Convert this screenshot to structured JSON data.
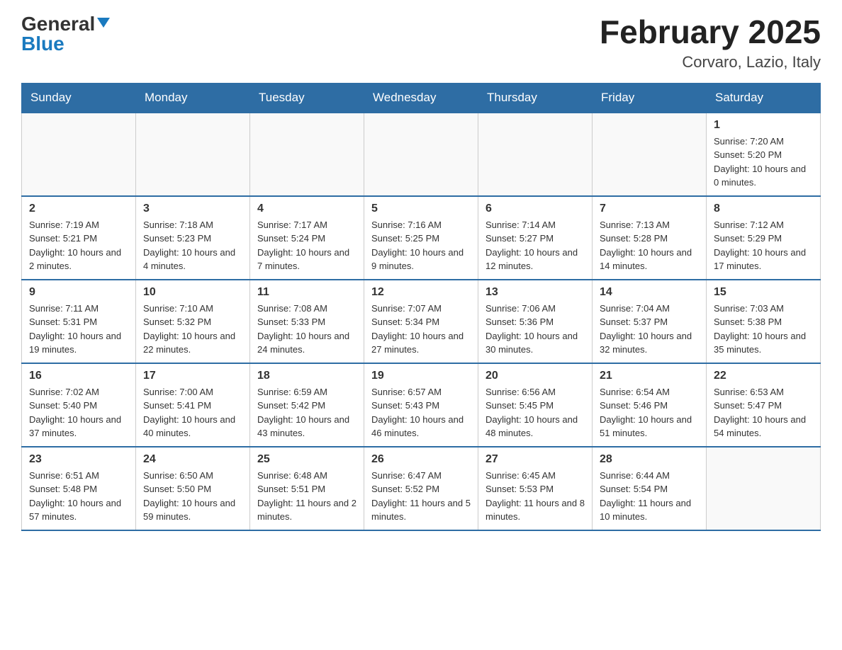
{
  "logo": {
    "general": "General",
    "blue": "Blue"
  },
  "header": {
    "month_title": "February 2025",
    "location": "Corvaro, Lazio, Italy"
  },
  "weekdays": [
    "Sunday",
    "Monday",
    "Tuesday",
    "Wednesday",
    "Thursday",
    "Friday",
    "Saturday"
  ],
  "weeks": [
    [
      {
        "day": "",
        "info": ""
      },
      {
        "day": "",
        "info": ""
      },
      {
        "day": "",
        "info": ""
      },
      {
        "day": "",
        "info": ""
      },
      {
        "day": "",
        "info": ""
      },
      {
        "day": "",
        "info": ""
      },
      {
        "day": "1",
        "info": "Sunrise: 7:20 AM\nSunset: 5:20 PM\nDaylight: 10 hours and 0 minutes."
      }
    ],
    [
      {
        "day": "2",
        "info": "Sunrise: 7:19 AM\nSunset: 5:21 PM\nDaylight: 10 hours and 2 minutes."
      },
      {
        "day": "3",
        "info": "Sunrise: 7:18 AM\nSunset: 5:23 PM\nDaylight: 10 hours and 4 minutes."
      },
      {
        "day": "4",
        "info": "Sunrise: 7:17 AM\nSunset: 5:24 PM\nDaylight: 10 hours and 7 minutes."
      },
      {
        "day": "5",
        "info": "Sunrise: 7:16 AM\nSunset: 5:25 PM\nDaylight: 10 hours and 9 minutes."
      },
      {
        "day": "6",
        "info": "Sunrise: 7:14 AM\nSunset: 5:27 PM\nDaylight: 10 hours and 12 minutes."
      },
      {
        "day": "7",
        "info": "Sunrise: 7:13 AM\nSunset: 5:28 PM\nDaylight: 10 hours and 14 minutes."
      },
      {
        "day": "8",
        "info": "Sunrise: 7:12 AM\nSunset: 5:29 PM\nDaylight: 10 hours and 17 minutes."
      }
    ],
    [
      {
        "day": "9",
        "info": "Sunrise: 7:11 AM\nSunset: 5:31 PM\nDaylight: 10 hours and 19 minutes."
      },
      {
        "day": "10",
        "info": "Sunrise: 7:10 AM\nSunset: 5:32 PM\nDaylight: 10 hours and 22 minutes."
      },
      {
        "day": "11",
        "info": "Sunrise: 7:08 AM\nSunset: 5:33 PM\nDaylight: 10 hours and 24 minutes."
      },
      {
        "day": "12",
        "info": "Sunrise: 7:07 AM\nSunset: 5:34 PM\nDaylight: 10 hours and 27 minutes."
      },
      {
        "day": "13",
        "info": "Sunrise: 7:06 AM\nSunset: 5:36 PM\nDaylight: 10 hours and 30 minutes."
      },
      {
        "day": "14",
        "info": "Sunrise: 7:04 AM\nSunset: 5:37 PM\nDaylight: 10 hours and 32 minutes."
      },
      {
        "day": "15",
        "info": "Sunrise: 7:03 AM\nSunset: 5:38 PM\nDaylight: 10 hours and 35 minutes."
      }
    ],
    [
      {
        "day": "16",
        "info": "Sunrise: 7:02 AM\nSunset: 5:40 PM\nDaylight: 10 hours and 37 minutes."
      },
      {
        "day": "17",
        "info": "Sunrise: 7:00 AM\nSunset: 5:41 PM\nDaylight: 10 hours and 40 minutes."
      },
      {
        "day": "18",
        "info": "Sunrise: 6:59 AM\nSunset: 5:42 PM\nDaylight: 10 hours and 43 minutes."
      },
      {
        "day": "19",
        "info": "Sunrise: 6:57 AM\nSunset: 5:43 PM\nDaylight: 10 hours and 46 minutes."
      },
      {
        "day": "20",
        "info": "Sunrise: 6:56 AM\nSunset: 5:45 PM\nDaylight: 10 hours and 48 minutes."
      },
      {
        "day": "21",
        "info": "Sunrise: 6:54 AM\nSunset: 5:46 PM\nDaylight: 10 hours and 51 minutes."
      },
      {
        "day": "22",
        "info": "Sunrise: 6:53 AM\nSunset: 5:47 PM\nDaylight: 10 hours and 54 minutes."
      }
    ],
    [
      {
        "day": "23",
        "info": "Sunrise: 6:51 AM\nSunset: 5:48 PM\nDaylight: 10 hours and 57 minutes."
      },
      {
        "day": "24",
        "info": "Sunrise: 6:50 AM\nSunset: 5:50 PM\nDaylight: 10 hours and 59 minutes."
      },
      {
        "day": "25",
        "info": "Sunrise: 6:48 AM\nSunset: 5:51 PM\nDaylight: 11 hours and 2 minutes."
      },
      {
        "day": "26",
        "info": "Sunrise: 6:47 AM\nSunset: 5:52 PM\nDaylight: 11 hours and 5 minutes."
      },
      {
        "day": "27",
        "info": "Sunrise: 6:45 AM\nSunset: 5:53 PM\nDaylight: 11 hours and 8 minutes."
      },
      {
        "day": "28",
        "info": "Sunrise: 6:44 AM\nSunset: 5:54 PM\nDaylight: 11 hours and 10 minutes."
      },
      {
        "day": "",
        "info": ""
      }
    ]
  ]
}
